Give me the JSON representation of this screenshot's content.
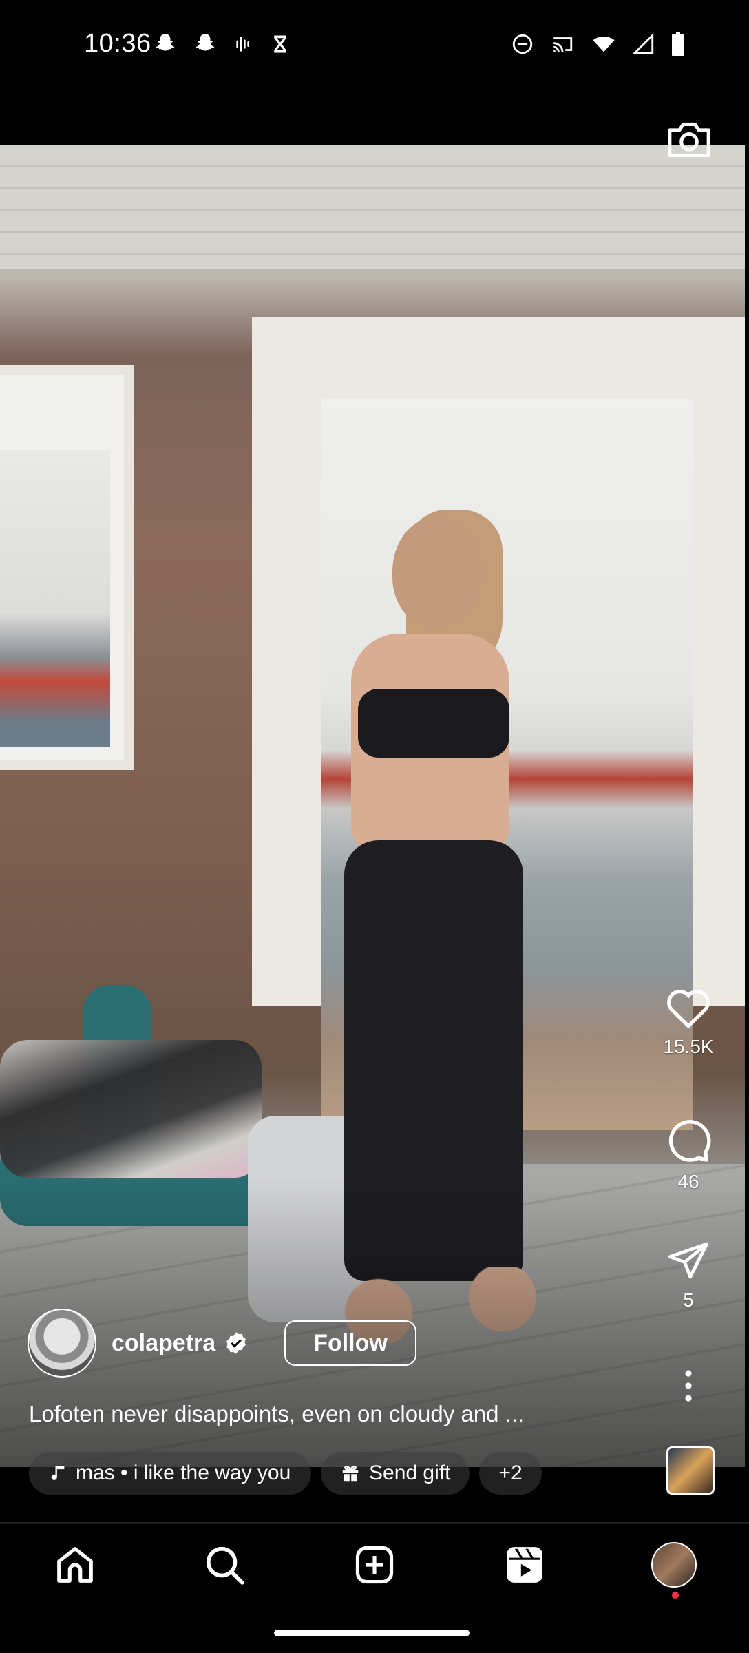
{
  "status_bar": {
    "time": "10:36",
    "left_icons": [
      "snapchat-icon",
      "snapchat-icon",
      "voice-icon",
      "hourglass-icon"
    ],
    "right_icons": [
      "do-not-disturb-icon",
      "cast-icon",
      "wifi-icon",
      "signal-icon",
      "battery-icon"
    ]
  },
  "reel": {
    "camera_icon": "camera-icon",
    "actions": {
      "like_count": "15.5K",
      "comment_count": "46",
      "share_count": "5"
    },
    "user": {
      "username": "colapetra",
      "verified": true,
      "follow_label": "Follow"
    },
    "caption": "Lofoten never disappoints, even on cloudy and ...",
    "chips": {
      "audio": "mas • i like the way you",
      "gift": "Send gift",
      "more": "+2"
    }
  },
  "bottom_nav": {
    "items": [
      "home-icon",
      "search-icon",
      "create-icon",
      "reels-icon",
      "profile-avatar"
    ]
  },
  "colors": {
    "background": "#000000",
    "text": "#ffffff",
    "notification_dot": "#ff3040"
  }
}
